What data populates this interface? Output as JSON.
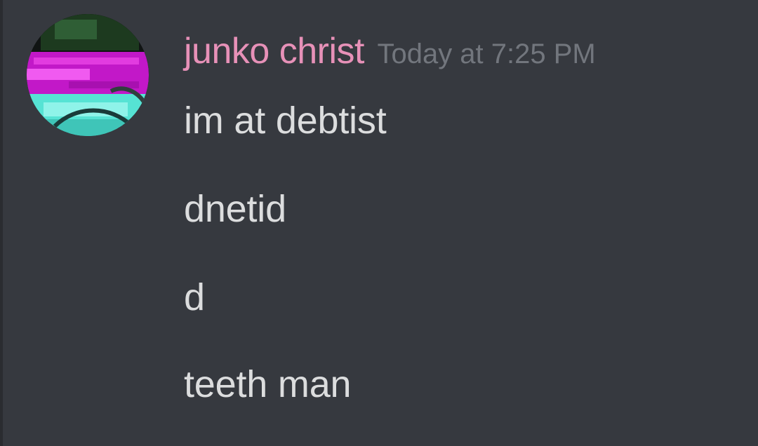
{
  "message": {
    "author": "junko christ",
    "timestamp": "Today at 7:25 PM",
    "lines": [
      "im at debtist",
      "dnetid",
      "d",
      "teeth man"
    ]
  },
  "colors": {
    "background": "#36393f",
    "username": "#e791b8",
    "timestamp": "#72767d",
    "text": "#dcddde"
  },
  "avatar": {
    "description_icon": "user-avatar"
  }
}
